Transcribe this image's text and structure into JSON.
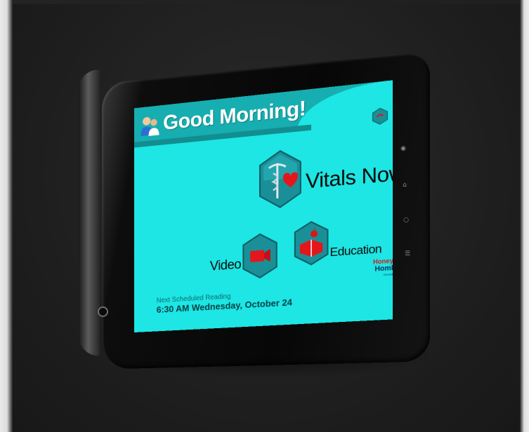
{
  "screen": {
    "greeting": "Good Morning!",
    "tiles": [
      {
        "label": "Vitals Now",
        "icon": "caduceus-heart-icon"
      },
      {
        "label": "Video",
        "icon": "video-camera-icon"
      },
      {
        "label": "Education",
        "icon": "book-apple-icon"
      }
    ],
    "next_reading": {
      "caption": "Next Scheduled Reading",
      "value": "6:30 AM Wednesday, October 24"
    },
    "brand": {
      "line1": "Honeywell",
      "line2": "HomMed",
      "line3": "Genesis Touch™"
    }
  },
  "colors": {
    "screen_bg": "#1de6e4",
    "banner": "#16aeb0",
    "hexagon": "#1a8f97",
    "accent_red": "#d8171c"
  }
}
